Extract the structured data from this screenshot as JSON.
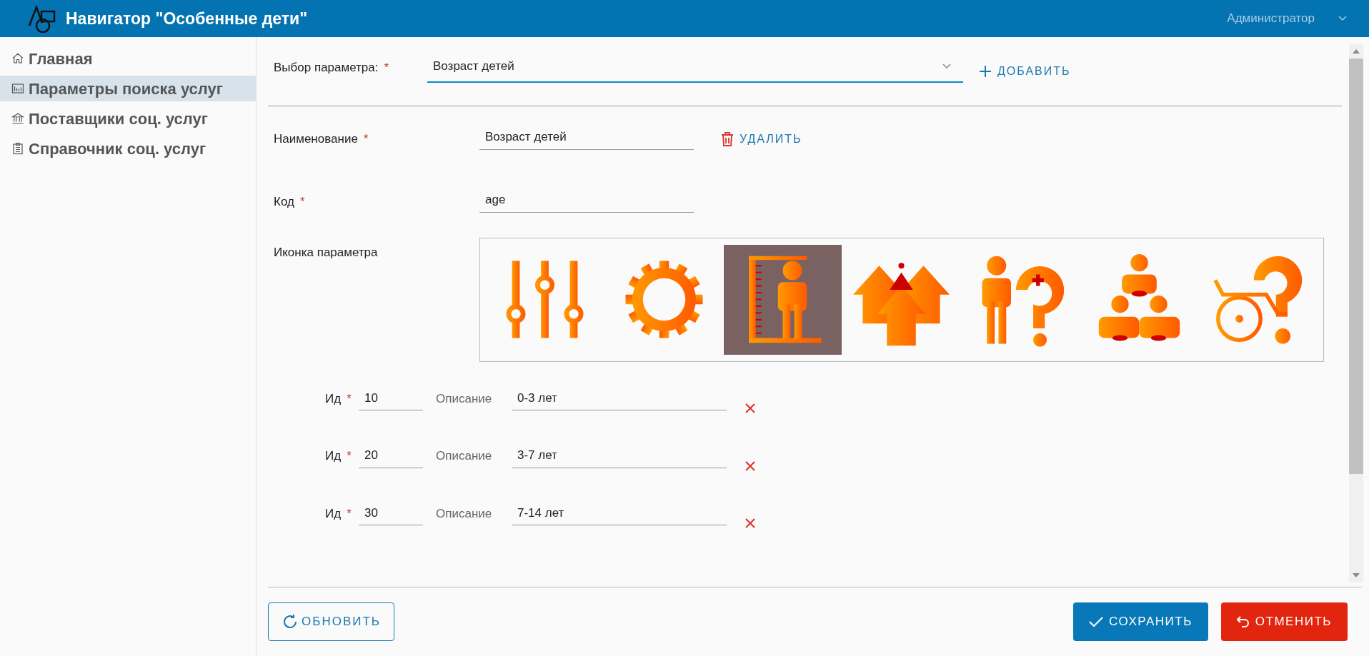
{
  "header": {
    "title": "Навигатор \"Особенные дети\"",
    "user": "Администратор"
  },
  "sidebar": {
    "items": [
      {
        "label": "Главная",
        "kind": "home",
        "selected": false
      },
      {
        "label": "Параметры поиска услуг",
        "kind": "chart",
        "selected": true
      },
      {
        "label": "Поставщики соц. услуг",
        "kind": "bank",
        "selected": false
      },
      {
        "label": "Справочник соц. услуг",
        "kind": "clipboard",
        "selected": false
      }
    ]
  },
  "param_select": {
    "label": "Выбор параметра:",
    "required_mark": "*",
    "value": "Возраст детей"
  },
  "add_button": {
    "label": "ДОБАВИТЬ"
  },
  "name_field": {
    "label": "Наименование",
    "required_mark": "*",
    "value": "Возраст детей"
  },
  "delete_button": {
    "label": "УДАЛИТЬ"
  },
  "code_field": {
    "label": "Код",
    "required_mark": "*",
    "value": "age"
  },
  "icon_picker": {
    "label": "Иконка параметра",
    "icons": [
      {
        "kind": "sliders",
        "selected": false
      },
      {
        "kind": "gear",
        "selected": false
      },
      {
        "kind": "height",
        "selected": true
      },
      {
        "kind": "growth",
        "selected": false
      },
      {
        "kind": "health",
        "selected": false
      },
      {
        "kind": "group",
        "selected": false
      },
      {
        "kind": "wheelchair",
        "selected": false
      }
    ]
  },
  "options": [
    {
      "id_label": "Ид",
      "required_mark": "*",
      "id": "10",
      "description_label": "Описание",
      "description": "0-3 лет"
    },
    {
      "id_label": "Ид",
      "required_mark": "*",
      "id": "20",
      "description_label": "Описание",
      "description": "3-7 лет"
    },
    {
      "id_label": "Ид",
      "required_mark": "*",
      "id": "30",
      "description_label": "Описание",
      "description": "7-14 лет"
    }
  ],
  "footer": {
    "refresh": "ОБНОВИТЬ",
    "save": "СОХРАНИТЬ",
    "cancel": "ОТМЕНИТЬ"
  }
}
